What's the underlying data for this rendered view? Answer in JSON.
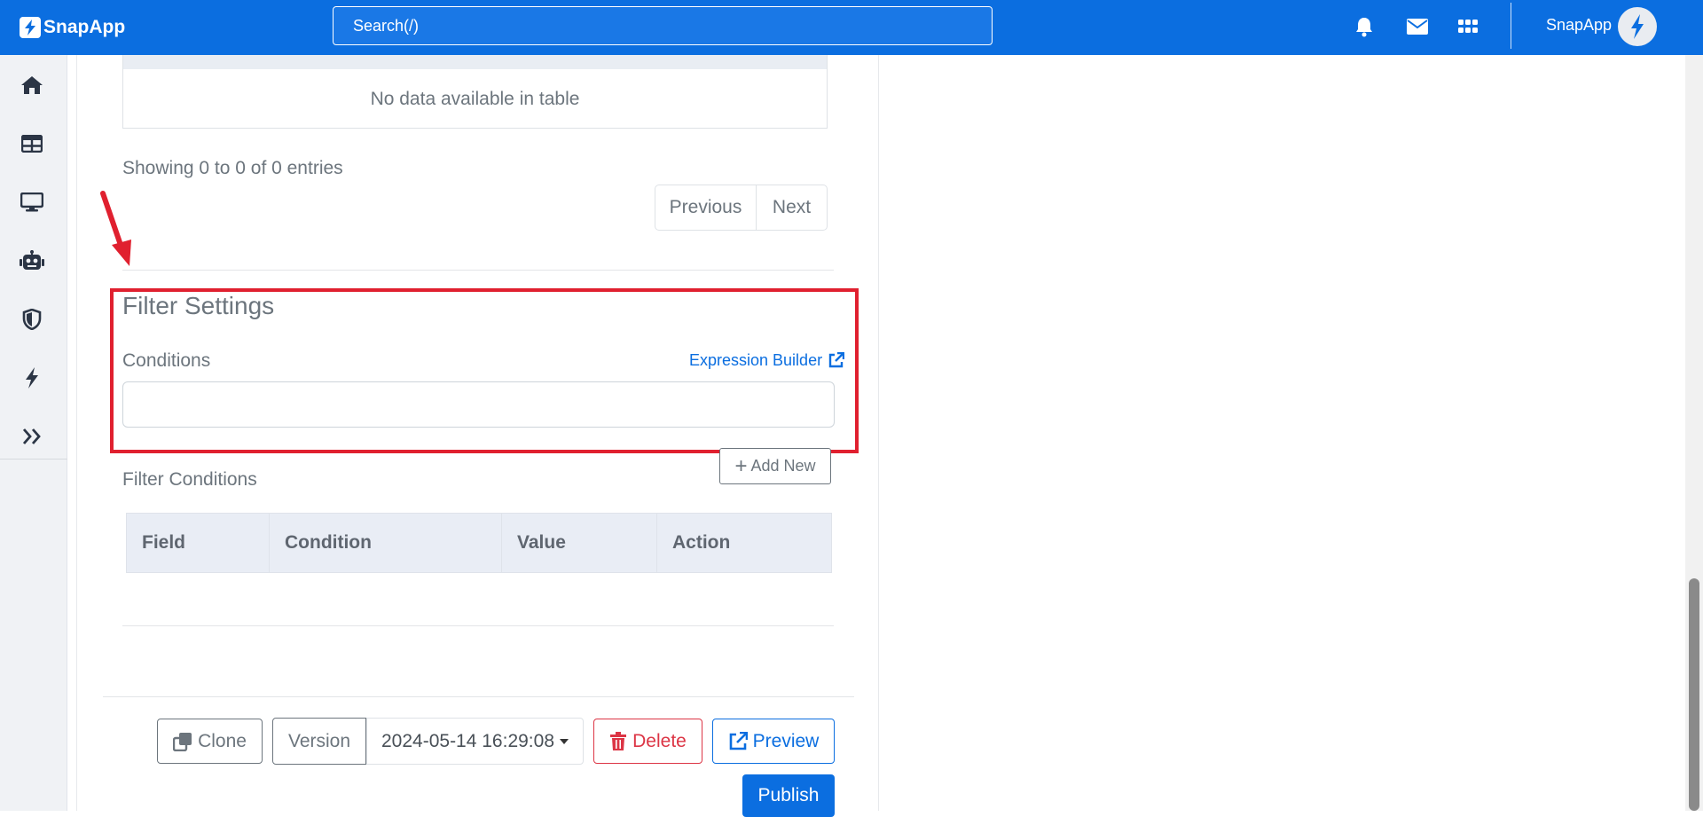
{
  "app": {
    "brand": "SnapApp",
    "user_name": "SnapApp"
  },
  "search": {
    "placeholder": "Search(/)"
  },
  "top_icons": [
    "bell-icon",
    "mail-icon",
    "grid-icon"
  ],
  "sidebar": {
    "items": [
      {
        "icon": "home-icon"
      },
      {
        "icon": "table-icon"
      },
      {
        "icon": "monitor-icon"
      },
      {
        "icon": "robot-icon"
      },
      {
        "icon": "shield-icon"
      },
      {
        "icon": "bolt-icon"
      },
      {
        "icon": "expand-icon"
      }
    ]
  },
  "results_table": {
    "empty_message": "No data available in table",
    "showing_text": "Showing 0 to 0 of 0 entries",
    "prev_label": "Previous",
    "next_label": "Next"
  },
  "filter_settings": {
    "title": "Filter Settings",
    "conditions_label": "Conditions",
    "expression_builder_label": "Expression Builder",
    "conditions_value": ""
  },
  "filter_conditions": {
    "label": "Filter Conditions",
    "add_new_label": "Add New",
    "columns": [
      "Field",
      "Condition",
      "Value",
      "Action"
    ]
  },
  "footer": {
    "clone_label": "Clone",
    "version_label": "Version",
    "version_value": "2024-05-14 16:29:08",
    "delete_label": "Delete",
    "preview_label": "Preview",
    "publish_label": "Publish"
  },
  "colors": {
    "primary": "#0b6ee0",
    "danger": "#dc3545",
    "highlight": "#e0202f",
    "muted": "#6c757d"
  }
}
